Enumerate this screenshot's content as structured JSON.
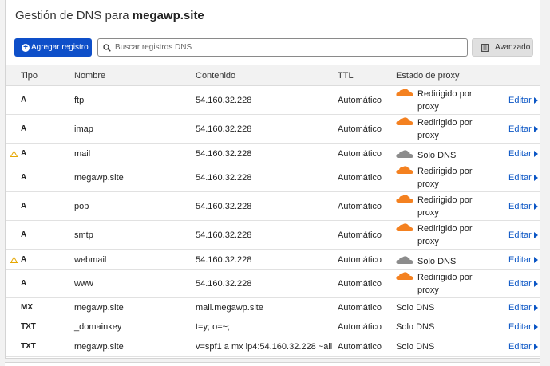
{
  "header": {
    "title_prefix": "Gestión de DNS para",
    "domain": "megawp.site"
  },
  "toolbar": {
    "add_label": "Agregar registro",
    "search_placeholder": "Buscar registros DNS",
    "advanced_label": "Avanzado"
  },
  "columns": {
    "type": "Tipo",
    "name": "Nombre",
    "content": "Contenido",
    "ttl": "TTL",
    "proxy": "Estado de proxy"
  },
  "colors": {
    "accent": "#0e4fc9",
    "link": "#0b56c5",
    "cloud_orange": "#f48120",
    "cloud_gray": "#8c8c8c",
    "warning": "#e6a700"
  },
  "edit_label": "Editar",
  "records": [
    {
      "type": "A",
      "name": "ftp",
      "content": "54.160.32.228",
      "ttl": "Automático",
      "proxy": "Redirigido por proxy",
      "proxied": true,
      "warning": false
    },
    {
      "type": "A",
      "name": "imap",
      "content": "54.160.32.228",
      "ttl": "Automático",
      "proxy": "Redirigido por proxy",
      "proxied": true,
      "warning": false
    },
    {
      "type": "A",
      "name": "mail",
      "content": "54.160.32.228",
      "ttl": "Automático",
      "proxy": "Solo DNS",
      "proxied": false,
      "warning": true
    },
    {
      "type": "A",
      "name": "megawp.site",
      "content": "54.160.32.228",
      "ttl": "Automático",
      "proxy": "Redirigido por proxy",
      "proxied": true,
      "warning": false
    },
    {
      "type": "A",
      "name": "pop",
      "content": "54.160.32.228",
      "ttl": "Automático",
      "proxy": "Redirigido por proxy",
      "proxied": true,
      "warning": false
    },
    {
      "type": "A",
      "name": "smtp",
      "content": "54.160.32.228",
      "ttl": "Automático",
      "proxy": "Redirigido por proxy",
      "proxied": true,
      "warning": false
    },
    {
      "type": "A",
      "name": "webmail",
      "content": "54.160.32.228",
      "ttl": "Automático",
      "proxy": "Solo DNS",
      "proxied": false,
      "warning": true
    },
    {
      "type": "A",
      "name": "www",
      "content": "54.160.32.228",
      "ttl": "Automático",
      "proxy": "Redirigido por proxy",
      "proxied": true,
      "warning": false
    },
    {
      "type": "MX",
      "name": "megawp.site",
      "content": "mail.megawp.site",
      "ttl": "Automático",
      "proxy": "Solo DNS",
      "proxied": null,
      "warning": false
    },
    {
      "type": "TXT",
      "name": "_domainkey",
      "content": "t=y; o=~;",
      "ttl": "Automático",
      "proxy": "Solo DNS",
      "proxied": null,
      "warning": false
    },
    {
      "type": "TXT",
      "name": "megawp.site",
      "content": "v=spf1 a mx ip4:54.160.32.228 ~all",
      "ttl": "Automático",
      "proxy": "Solo DNS",
      "proxied": null,
      "warning": false
    }
  ]
}
